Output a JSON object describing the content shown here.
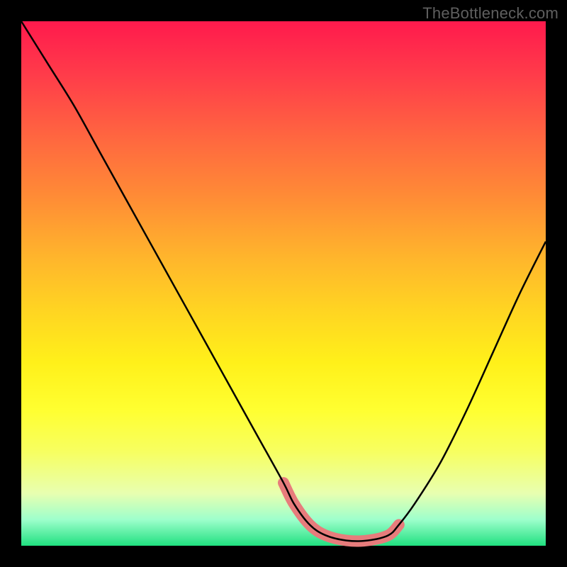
{
  "watermark": "TheBottleneck.com",
  "chart_data": {
    "type": "line",
    "title": "",
    "xlabel": "",
    "ylabel": "",
    "xlim": [
      0,
      100
    ],
    "ylim": [
      0,
      100
    ],
    "x": [
      0,
      5,
      10,
      15,
      20,
      25,
      30,
      35,
      40,
      45,
      50,
      52,
      55,
      58,
      62,
      66,
      70,
      72,
      75,
      80,
      85,
      90,
      95,
      100
    ],
    "values": [
      100,
      92,
      84,
      75,
      66,
      57,
      48,
      39,
      30,
      21,
      12,
      8,
      4,
      2,
      1,
      1,
      2,
      4,
      8,
      16,
      26,
      37,
      48,
      58
    ],
    "highlight_band_percent": [
      50,
      72
    ],
    "colors": {
      "curve": "#000000",
      "highlight": "#e77c7c"
    }
  }
}
